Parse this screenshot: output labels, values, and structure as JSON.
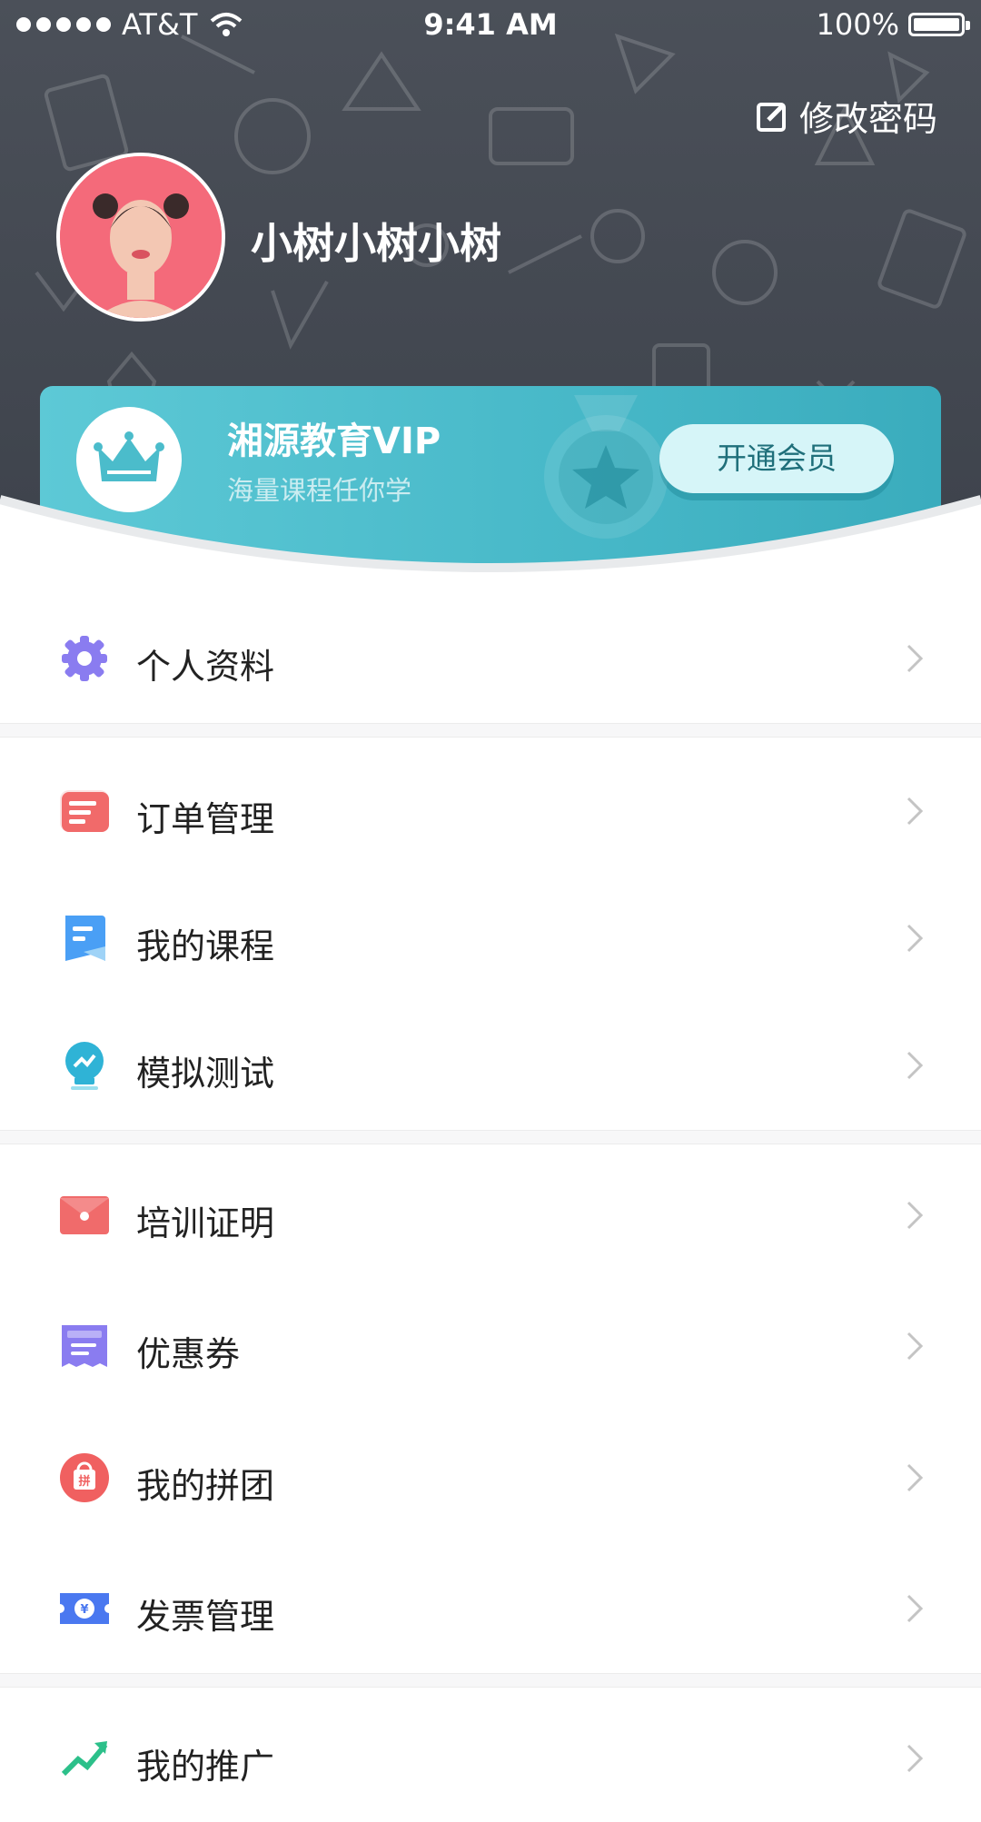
{
  "status_bar": {
    "carrier": "AT&T",
    "time": "9:41 AM",
    "battery": "100%"
  },
  "header": {
    "edit_password_label": "修改密码",
    "username": "小树小树小树"
  },
  "vip_card": {
    "title": "湘源教育VIP",
    "subtitle": "海量课程任你学",
    "button_label": "开通会员"
  },
  "menu": {
    "items": [
      {
        "label": "个人资料",
        "icon": "gear-icon",
        "color": "#8a7cf0"
      },
      {
        "label": "订单管理",
        "icon": "order-icon",
        "color": "#f16a6a"
      },
      {
        "label": "我的课程",
        "icon": "course-icon",
        "color": "#4a9ff5"
      },
      {
        "label": "模拟测试",
        "icon": "bulb-test-icon",
        "color": "#2fb3d6"
      },
      {
        "label": "培训证明",
        "icon": "certificate-icon",
        "color": "#f06b6b"
      },
      {
        "label": "优惠券",
        "icon": "coupon-icon",
        "color": "#8a7cf0"
      },
      {
        "label": "我的拼团",
        "icon": "group-buy-icon",
        "color": "#f06060"
      },
      {
        "label": "发票管理",
        "icon": "invoice-icon",
        "color": "#4a78f0"
      },
      {
        "label": "我的推广",
        "icon": "promotion-icon",
        "color": "#2cc08a"
      }
    ]
  },
  "colors": {
    "header_bg": "#454a53",
    "vip_accent": "#4bbccb"
  }
}
